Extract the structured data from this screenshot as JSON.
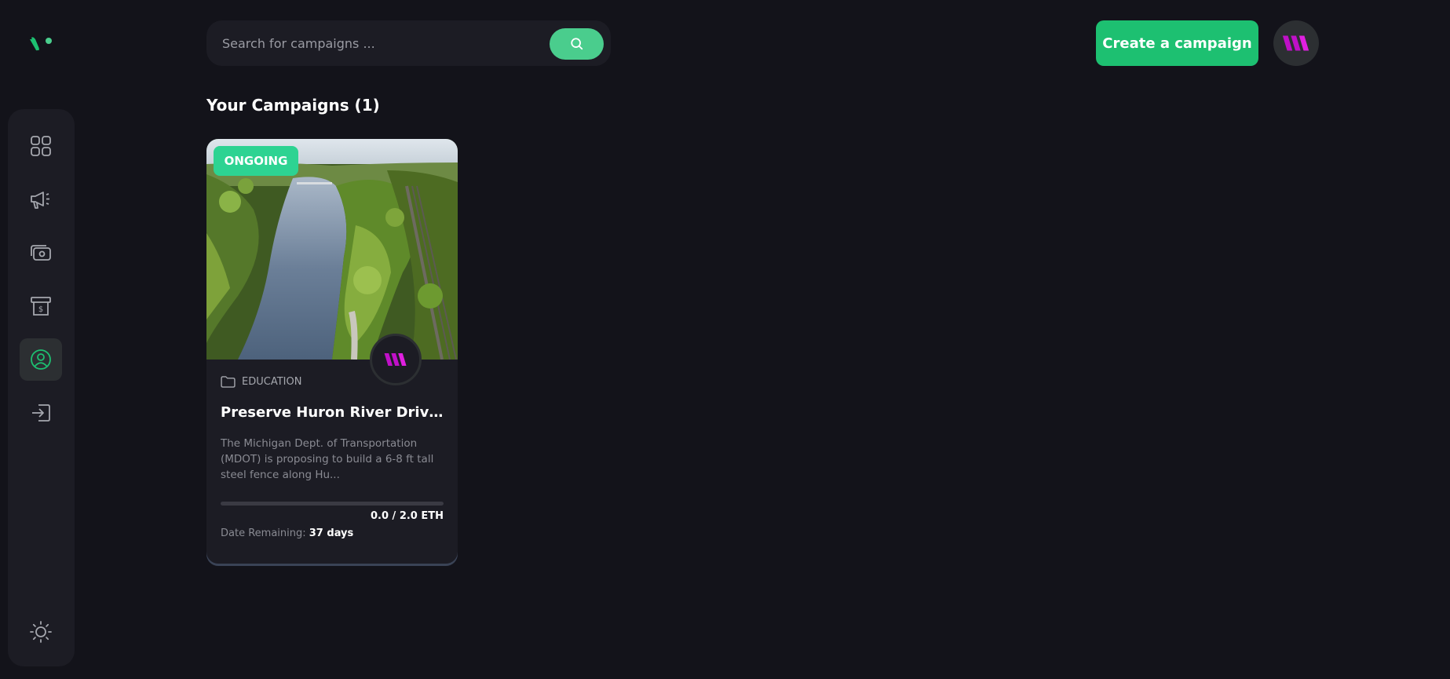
{
  "search": {
    "placeholder": "Search for campaigns ..."
  },
  "header": {
    "create_label": "Create a campaign"
  },
  "section": {
    "title": "Your Campaigns (1)"
  },
  "colors": {
    "accent": "#1dc071",
    "accent_light": "#4acd8d",
    "badge": "#2dd392",
    "background": "#13131a",
    "surface": "#1c1c24",
    "brand": "#c010c8"
  },
  "sidebar": {
    "items": [
      {
        "icon": "dashboard-icon",
        "active": false
      },
      {
        "icon": "megaphone-icon",
        "active": false
      },
      {
        "icon": "payment-icon",
        "active": false
      },
      {
        "icon": "withdraw-icon",
        "active": false
      },
      {
        "icon": "profile-icon",
        "active": true
      },
      {
        "icon": "logout-icon",
        "active": false
      }
    ],
    "theme_icon": "sun-icon"
  },
  "campaign": {
    "status": "ONGOING",
    "category": "EDUCATION",
    "title": "Preserve Huron River Drive (A...",
    "description": "The Michigan Dept. of Transportation (MDOT) is proposing to build a 6-8 ft tall steel fence along Hu...",
    "amount": "0.0 / 2.0 ETH",
    "progress": 0,
    "remaining_label": "Date Remaining:",
    "remaining_value": "37 days"
  }
}
